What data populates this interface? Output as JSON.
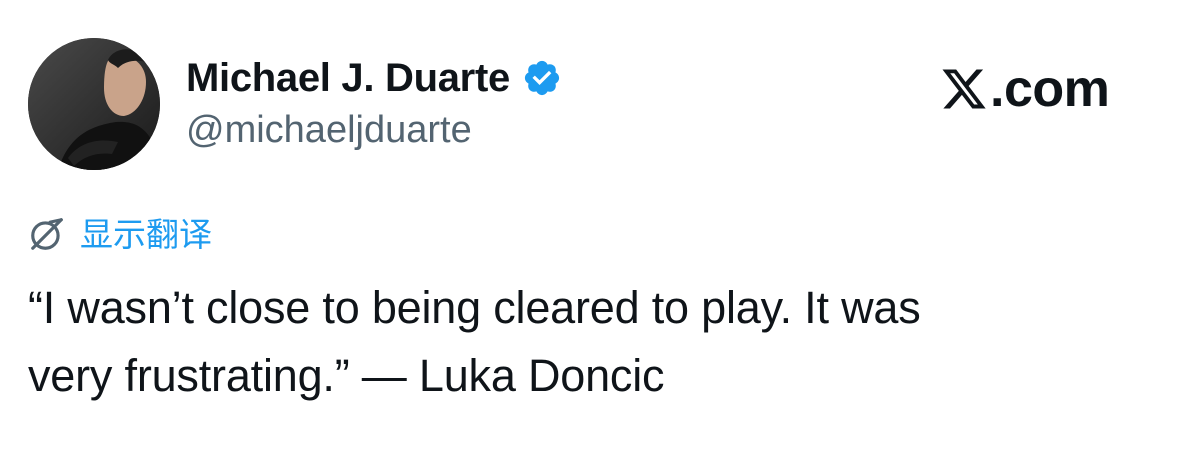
{
  "author": {
    "display_name": "Michael J. Duarte",
    "handle": "@michaeljduarte",
    "verified": true,
    "verified_icon": "verified-badge-icon",
    "verified_color": "#1d9bf0"
  },
  "brand": {
    "logo_icon": "x-logo-icon",
    "text": ".com"
  },
  "translate": {
    "icon": "globe-icon",
    "label": "显示翻译",
    "color": "#1d9bf0"
  },
  "tweet": {
    "line1": "“I wasn’t close to being cleared to play. It was",
    "line2": "very frustrating.” — Luka Doncic"
  },
  "colors": {
    "text_primary": "#0f1419",
    "text_secondary": "#536471",
    "accent": "#1d9bf0"
  }
}
